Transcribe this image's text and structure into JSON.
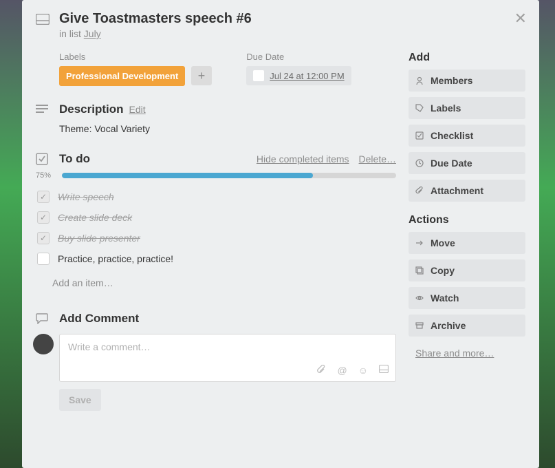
{
  "title": "Give Toastmasters speech #6",
  "in_list_prefix": "in list ",
  "list_name": "July",
  "labels_heading": "Labels",
  "label_value": "Professional Development",
  "due_heading": "Due Date",
  "due_value": "Jul 24 at 12:00 PM",
  "description_heading": "Description",
  "edit_label": "Edit",
  "description_body": "Theme: Vocal Variety",
  "checklist": {
    "title": "To do",
    "hide_label": "Hide completed items",
    "delete_label": "Delete…",
    "percent": "75%",
    "percent_num": 75,
    "items": [
      {
        "text": "Write speech",
        "done": true
      },
      {
        "text": "Create slide deck",
        "done": true
      },
      {
        "text": "Buy slide presenter",
        "done": true
      },
      {
        "text": "Practice, practice, practice!",
        "done": false
      }
    ],
    "add_item": "Add an item…"
  },
  "comment": {
    "heading": "Add Comment",
    "placeholder": "Write a comment…",
    "save": "Save"
  },
  "sidebar": {
    "add_heading": "Add",
    "add_buttons": {
      "members": "Members",
      "labels": "Labels",
      "checklist": "Checklist",
      "due_date": "Due Date",
      "attachment": "Attachment"
    },
    "actions_heading": "Actions",
    "action_buttons": {
      "move": "Move",
      "copy": "Copy",
      "watch": "Watch",
      "archive": "Archive"
    },
    "share": "Share and more…"
  }
}
